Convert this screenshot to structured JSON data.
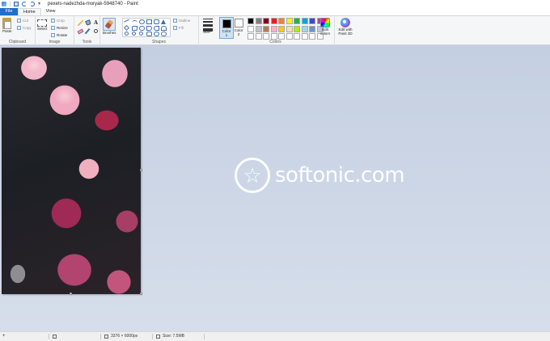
{
  "window": {
    "title": "pexels-nadezhda-moryak-5948740 - Paint"
  },
  "quick_access": {
    "icons": [
      "paint-app-icon",
      "save-icon",
      "undo-icon",
      "redo-icon",
      "customize-caret-icon"
    ],
    "caret": "▾"
  },
  "tabs": [
    {
      "label": "File"
    },
    {
      "label": "Home"
    },
    {
      "label": "View"
    }
  ],
  "ribbon": {
    "clipboard": {
      "paste": "Paste",
      "cut": "Cut",
      "copy": "Copy",
      "label": "Clipboard"
    },
    "image": {
      "select": "Select",
      "crop": "Crop",
      "resize": "Resize",
      "rotate": "Rotate",
      "label": "Image"
    },
    "tools": {
      "label": "Tools",
      "text_glyph": "A"
    },
    "brushes": {
      "label": "Brushes"
    },
    "shapes": {
      "outline": "Outline",
      "fill": "Fill",
      "label": "Shapes"
    },
    "size": {
      "label": "Size"
    },
    "colors": {
      "color1": "Color 1",
      "color2": "Color 2",
      "color1_value": "#000000",
      "color2_value": "#ffffff",
      "palette": [
        "#000000",
        "#7f7f7f",
        "#880015",
        "#ed1c24",
        "#ff7f27",
        "#fff200",
        "#22b14c",
        "#00a2e8",
        "#3f48cc",
        "#a349a4",
        "#ffffff",
        "#c3c3c3",
        "#b97a57",
        "#ffaec9",
        "#ffc90e",
        "#efe4b0",
        "#b5e61d",
        "#99d9ea",
        "#7092be",
        "#c8bfe7",
        "#ffffff",
        "#ffffff",
        "#ffffff",
        "#ffffff",
        "#ffffff",
        "#ffffff",
        "#ffffff",
        "#ffffff",
        "#ffffff",
        "#ffffff"
      ],
      "edit_colors": "Edit colors",
      "label": "Colors"
    },
    "paint3d": {
      "label": "Edit with Paint 3D"
    }
  },
  "canvas": {
    "watermark": "softonic.com"
  },
  "status": {
    "dimensions": "3376 × 6000px",
    "size": "Size: 7.5MB"
  }
}
